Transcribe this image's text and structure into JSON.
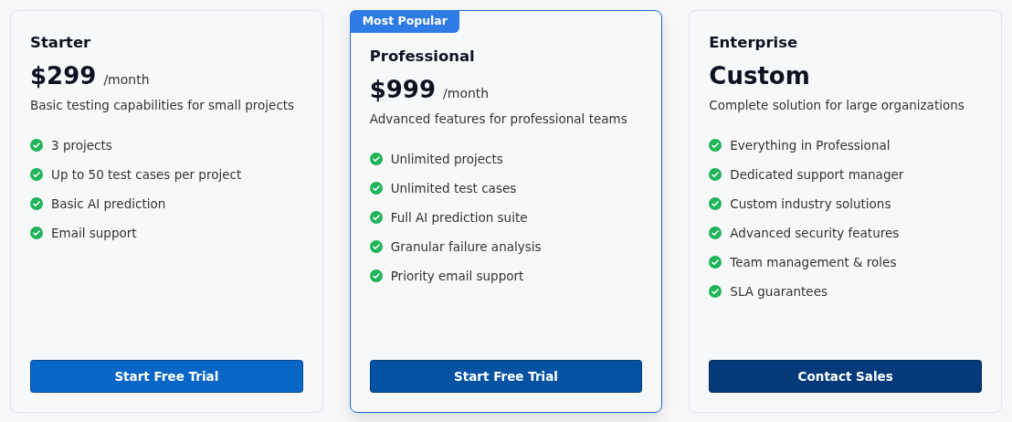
{
  "plans": [
    {
      "name": "Starter",
      "price": "$299",
      "period": "/month",
      "description": "Basic testing capabilities for small projects",
      "features": [
        "3 projects",
        "Up to 50 test cases per project",
        "Basic AI prediction",
        "Email support"
      ],
      "button": "Start Free Trial",
      "color": "#0866c6",
      "featured": false
    },
    {
      "name": "Professional",
      "badge": "Most Popular",
      "price": "$999",
      "period": "/month",
      "description": "Advanced features for professional teams",
      "features": [
        "Unlimited projects",
        "Unlimited test cases",
        "Full AI prediction suite",
        "Granular failure analysis",
        "Priority email support"
      ],
      "button": "Start Free Trial",
      "color": "#0552a3",
      "featured": true
    },
    {
      "name": "Enterprise",
      "price": "Custom",
      "description": "Complete solution for large organizations",
      "features": [
        "Everything in Professional",
        "Dedicated support manager",
        "Custom industry solutions",
        "Advanced security features",
        "Team management & roles",
        "SLA guarantees"
      ],
      "button": "Contact Sales",
      "color": "#043a7a",
      "featured": false
    }
  ]
}
